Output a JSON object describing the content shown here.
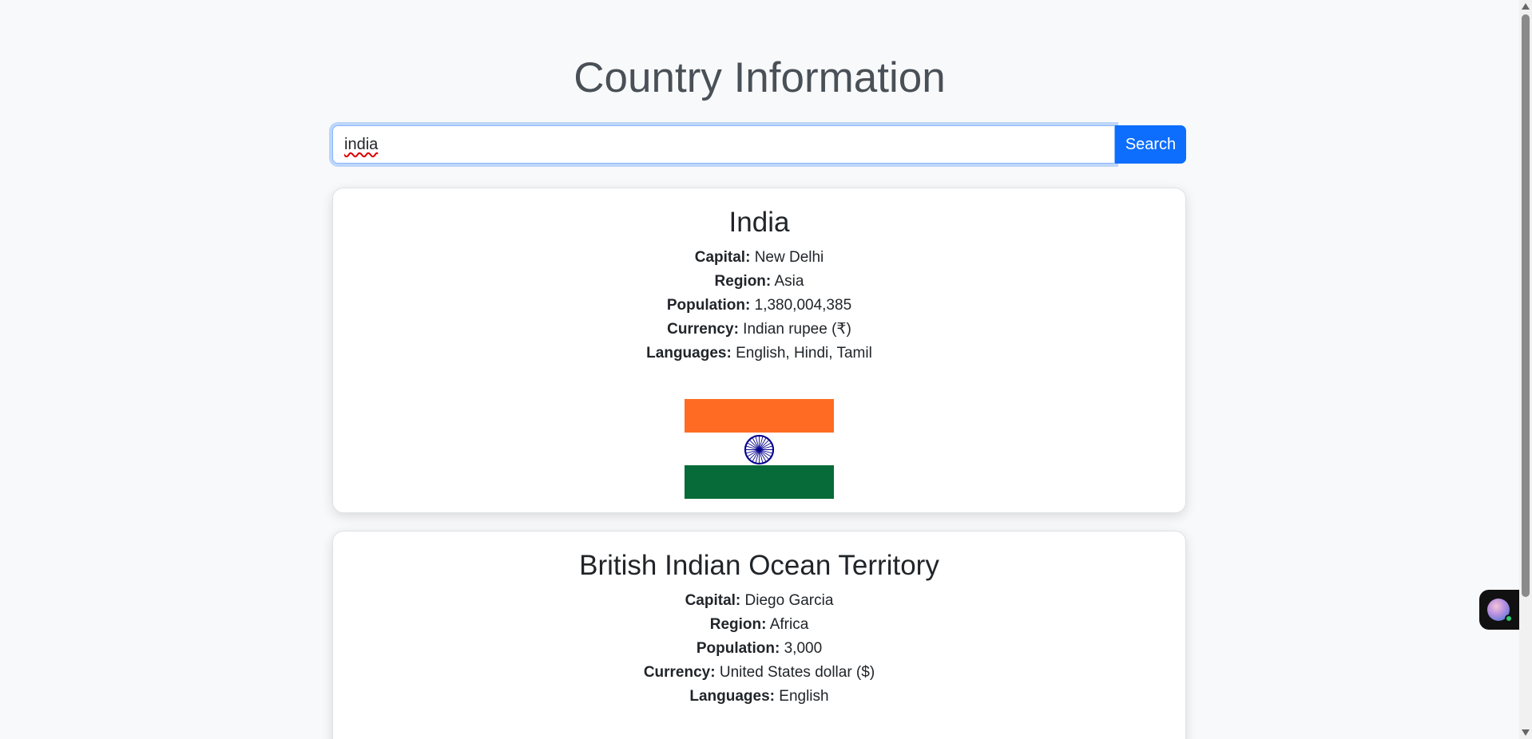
{
  "page": {
    "title": "Country Information"
  },
  "search": {
    "value": "india",
    "button_label": "Search"
  },
  "countries": [
    {
      "name": "India",
      "fields": [
        {
          "label": "Capital:",
          "value": "New Delhi"
        },
        {
          "label": "Region:",
          "value": "Asia"
        },
        {
          "label": "Population:",
          "value": "1,380,004,385"
        },
        {
          "label": "Currency:",
          "value": "Indian rupee (₹)"
        },
        {
          "label": "Languages:",
          "value": "English, Hindi, Tamil"
        }
      ],
      "flag": {
        "icon": "india-flag-icon",
        "colors": {
          "saffron": "#ff6b22",
          "white": "#ffffff",
          "green": "#066b38",
          "chakra": "#06038d"
        }
      }
    },
    {
      "name": "British Indian Ocean Territory",
      "fields": [
        {
          "label": "Capital:",
          "value": "Diego Garcia"
        },
        {
          "label": "Region:",
          "value": "Africa"
        },
        {
          "label": "Population:",
          "value": "3,000"
        },
        {
          "label": "Currency:",
          "value": "United States dollar ($)"
        },
        {
          "label": "Languages:",
          "value": "English"
        }
      ]
    }
  ],
  "theme": {
    "accent": "#0d6efd",
    "background": "#f8f9fa",
    "title_color": "#495057"
  },
  "widgets": {
    "assistant_icon": "assistant-avatar-icon"
  }
}
